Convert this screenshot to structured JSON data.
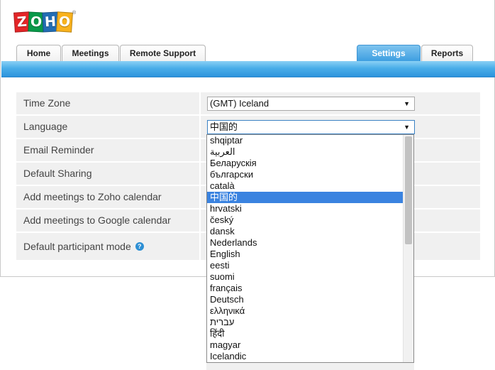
{
  "logo": {
    "letters": [
      "Z",
      "O",
      "H",
      "O"
    ],
    "colors": [
      "#e42527",
      "#089949",
      "#226db4",
      "#f9b21d"
    ],
    "registered": "®"
  },
  "tabs": [
    {
      "label": "Home",
      "active": false
    },
    {
      "label": "Meetings",
      "active": false
    },
    {
      "label": "Remote Support",
      "active": false
    },
    {
      "label": "Settings",
      "active": true
    },
    {
      "label": "Reports",
      "active": false
    }
  ],
  "settings": {
    "rows": [
      {
        "label": "Time Zone",
        "value": "(GMT) Iceland"
      },
      {
        "label": "Language",
        "value": "中国的"
      },
      {
        "label": "Email Reminder"
      },
      {
        "label": "Default Sharing"
      },
      {
        "label": "Add meetings to Zoho calendar"
      },
      {
        "label": "Add meetings to Google calendar"
      },
      {
        "label": "Default participant mode",
        "help": "?"
      }
    ],
    "arrow": "▼"
  },
  "language_dropdown": {
    "selected": "中国的",
    "options": [
      "shqiptar",
      "العربية",
      "Беларускія",
      "български",
      "català",
      "中国的",
      "hrvatski",
      "český",
      "dansk",
      "Nederlands",
      "English",
      "eesti",
      "suomi",
      "français",
      "Deutsch",
      "ελληνικά",
      "עברית",
      "हिंदी",
      "magyar",
      "Icelandic"
    ]
  },
  "colors": {
    "accent_blue": "#3a9ee2",
    "selected_option": "#3a83e0",
    "row_background": "#f0f0f0"
  }
}
